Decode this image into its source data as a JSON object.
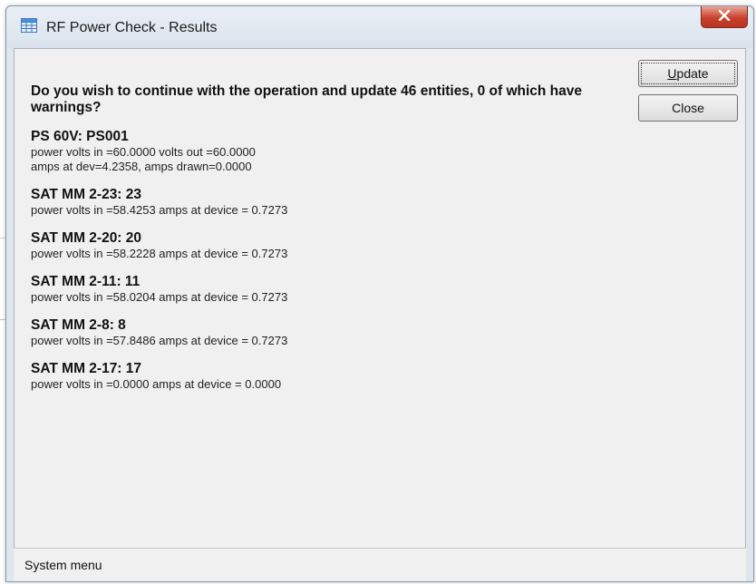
{
  "window": {
    "title": "RF Power Check - Results",
    "close_symbol": "x"
  },
  "message": {
    "question": "Do you wish to continue with the operation and update 46 entities, 0 of which have warnings?"
  },
  "entities": [
    {
      "name": "PS 60V: PS001",
      "detail": "power volts in =60.0000 volts out =60.0000\namps at dev=4.2358, amps drawn=0.0000"
    },
    {
      "name": "SAT MM 2-23: 23",
      "detail": "power volts in =58.4253 amps at device = 0.7273"
    },
    {
      "name": "SAT MM 2-20: 20",
      "detail": "power volts in =58.2228 amps at device = 0.7273"
    },
    {
      "name": "SAT MM 2-11: 11",
      "detail": "power volts in =58.0204 amps at device = 0.7273"
    },
    {
      "name": "SAT MM 2-8: 8",
      "detail": "power volts in =57.8486 amps at device = 0.7273"
    },
    {
      "name": "SAT MM 2-17: 17",
      "detail": "power volts in =0.0000 amps at device = 0.0000"
    }
  ],
  "buttons": {
    "update_label": "Update",
    "close_label": "Close"
  },
  "statusbar": {
    "text": "System menu"
  },
  "icons": {
    "app": "table-window-icon",
    "close": "close-x-icon"
  },
  "colors": {
    "close_button": "#c9402b",
    "client_bg": "#f0f0f0",
    "frame": "#dfe6ee"
  }
}
